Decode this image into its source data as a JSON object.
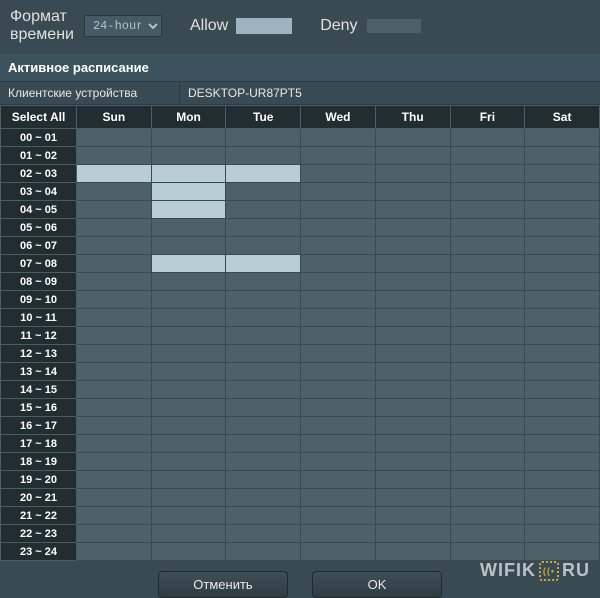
{
  "top": {
    "format_label": "Формат\nвремени",
    "format_value": "24-hour",
    "allow_label": "Allow",
    "deny_label": "Deny"
  },
  "section_header": "Активное расписание",
  "devices": {
    "label": "Клиентские устройства",
    "value": "DESKTOP-UR87PT5"
  },
  "schedule": {
    "select_all": "Select All",
    "days": [
      "Sun",
      "Mon",
      "Tue",
      "Wed",
      "Thu",
      "Fri",
      "Sat"
    ],
    "hours": [
      "00 ~ 01",
      "01 ~ 02",
      "02 ~ 03",
      "03 ~ 04",
      "04 ~ 05",
      "05 ~ 06",
      "06 ~ 07",
      "07 ~ 08",
      "08 ~ 09",
      "09 ~ 10",
      "10 ~ 11",
      "11 ~ 12",
      "12 ~ 13",
      "13 ~ 14",
      "14 ~ 15",
      "15 ~ 16",
      "16 ~ 17",
      "17 ~ 18",
      "18 ~ 19",
      "19 ~ 20",
      "20 ~ 21",
      "21 ~ 22",
      "22 ~ 23",
      "23 ~ 24"
    ],
    "allow_cells": [
      [
        2,
        0
      ],
      [
        2,
        1
      ],
      [
        2,
        2
      ],
      [
        3,
        1
      ],
      [
        4,
        1
      ],
      [
        7,
        1
      ],
      [
        7,
        2
      ]
    ]
  },
  "buttons": {
    "cancel": "Отменить",
    "ok": "OK"
  },
  "watermark": {
    "p1": "WIFIK",
    "p2": "RU"
  }
}
